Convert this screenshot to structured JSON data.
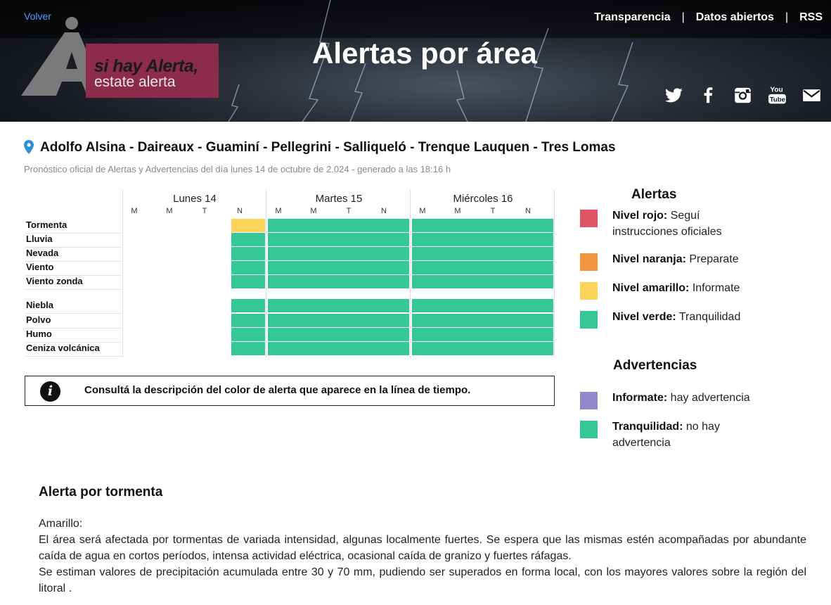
{
  "header": {
    "back_link": "Volver",
    "nav": [
      "Transparencia",
      "Datos abiertos",
      "RSS"
    ],
    "logo_line1": "si hay Alerta,",
    "logo_line2": "estate alerta",
    "title": "Alertas por área",
    "social_icons": [
      "twitter-icon",
      "facebook-icon",
      "instagram-icon",
      "youtube-icon",
      "mail-icon"
    ]
  },
  "area": {
    "name": "Adolfo Alsina - Daireaux - Guaminí - Pellegrini - Salliqueló - Trenque Lauquen - Tres Lomas",
    "subtitle": "Pronóstico oficial de Alertas y Advertencias del día lunes 14 de octubre de 2.024 - generado a las 18:16 h"
  },
  "timeline": {
    "days": [
      "Lunes 14",
      "Martes 15",
      "Miércoles 16"
    ],
    "slots": [
      "M",
      "M",
      "T",
      "N"
    ],
    "alerts": [
      {
        "label": "Tormenta",
        "levels": [
          "",
          "",
          "",
          "amarillo",
          "verde",
          "verde",
          "verde",
          "verde",
          "verde",
          "verde",
          "verde",
          "verde"
        ]
      },
      {
        "label": "Lluvia",
        "levels": [
          "",
          "",
          "",
          "verde",
          "verde",
          "verde",
          "verde",
          "verde",
          "verde",
          "verde",
          "verde",
          "verde"
        ]
      },
      {
        "label": "Nevada",
        "levels": [
          "",
          "",
          "",
          "verde",
          "verde",
          "verde",
          "verde",
          "verde",
          "verde",
          "verde",
          "verde",
          "verde"
        ]
      },
      {
        "label": "Viento",
        "levels": [
          "",
          "",
          "",
          "verde",
          "verde",
          "verde",
          "verde",
          "verde",
          "verde",
          "verde",
          "verde",
          "verde"
        ]
      },
      {
        "label": "Viento zonda",
        "levels": [
          "",
          "",
          "",
          "verde",
          "verde",
          "verde",
          "verde",
          "verde",
          "verde",
          "verde",
          "verde",
          "verde"
        ]
      }
    ],
    "warnings": [
      {
        "label": "Niebla",
        "levels": [
          "",
          "",
          "",
          "verde",
          "verde",
          "verde",
          "verde",
          "verde",
          "verde",
          "verde",
          "verde",
          "verde"
        ]
      },
      {
        "label": "Polvo",
        "levels": [
          "",
          "",
          "",
          "verde",
          "verde",
          "verde",
          "verde",
          "verde",
          "verde",
          "verde",
          "verde",
          "verde"
        ]
      },
      {
        "label": "Humo",
        "levels": [
          "",
          "",
          "",
          "verde",
          "verde",
          "verde",
          "verde",
          "verde",
          "verde",
          "verde",
          "verde",
          "verde"
        ]
      },
      {
        "label": "Ceniza volcánica",
        "levels": [
          "",
          "",
          "",
          "verde",
          "verde",
          "verde",
          "verde",
          "verde",
          "verde",
          "verde",
          "verde",
          "verde"
        ]
      }
    ]
  },
  "info_box": "Consultá la descripción del color de alerta que aparece en la línea de tiempo.",
  "legend": {
    "alerts_title": "Alertas",
    "alerts": [
      {
        "level": "Nivel rojo:",
        "text": " Seguí instrucciones oficiales",
        "color": "#e05565"
      },
      {
        "level": "Nivel naranja:",
        "text": " Preparate",
        "color": "#f2953f"
      },
      {
        "level": "Nivel amarillo:",
        "text": " Informate",
        "color": "#fcd55a"
      },
      {
        "level": "Nivel verde:",
        "text": " Tranquilidad",
        "color": "#35c895"
      }
    ],
    "warnings_title": "Advertencias",
    "warnings": [
      {
        "level": "Informate:",
        "text": " hay advertencia",
        "color": "#9189c9"
      },
      {
        "level": "Tranquilidad:",
        "text": " no hay advertencia",
        "color": "#35c895"
      }
    ]
  },
  "colors": {
    "amarillo": "#fcd55a",
    "verde": "#35c895",
    "naranja": "#f2953f",
    "rojo": "#e05565"
  },
  "description": {
    "title": "Alerta por tormenta",
    "level": "Amarillo:",
    "paragraph1": "El área será afectada por tormentas de variada intensidad, algunas localmente fuertes. Se espera que las mismas estén acompañadas por abundante caída de agua en cortos períodos, intensa actividad eléctrica, ocasional caída de granizo y fuertes ráfagas.",
    "paragraph2": "Se estiman valores de precipitación acumulada entre 30 y 70 mm, pudiendo ser superados en forma local, con los mayores valores sobre la región del litoral ."
  }
}
